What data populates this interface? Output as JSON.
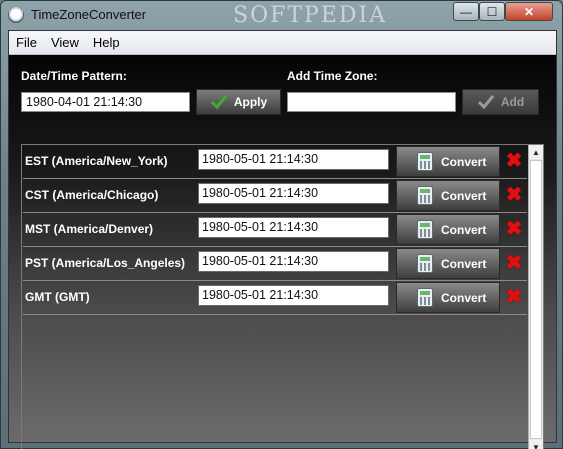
{
  "window": {
    "title": "TimeZoneConverter",
    "watermark": "SOFTPEDIA",
    "min_glyph": "—",
    "max_glyph": "☐",
    "close_glyph": "✕"
  },
  "menu": [
    "File",
    "View",
    "Help"
  ],
  "pattern": {
    "label": "Date/Time Pattern:",
    "value": "1980-04-01 21:14:30",
    "apply_label": "Apply"
  },
  "add_zone": {
    "label": "Add Time Zone:",
    "value": "",
    "add_label": "Add"
  },
  "zones": [
    {
      "label": "EST (America/New_York)",
      "value": "1980-05-01 21:14:30",
      "convert_label": "Convert"
    },
    {
      "label": "CST (America/Chicago)",
      "value": "1980-05-01 21:14:30",
      "convert_label": "Convert"
    },
    {
      "label": "MST (America/Denver)",
      "value": "1980-05-01 21:14:30",
      "convert_label": "Convert"
    },
    {
      "label": "PST (America/Los_Angeles)",
      "value": "1980-05-01 21:14:30",
      "convert_label": "Convert"
    },
    {
      "label": "GMT (GMT)",
      "value": "1980-05-01 21:14:30",
      "convert_label": "Convert"
    }
  ],
  "icons": {
    "apply": "checkmark-icon",
    "add": "checkmark-icon",
    "convert": "calculator-icon",
    "remove": "red-x-icon"
  },
  "colors": {
    "remove": "#e01010",
    "apply_check": "#3fae2a"
  }
}
